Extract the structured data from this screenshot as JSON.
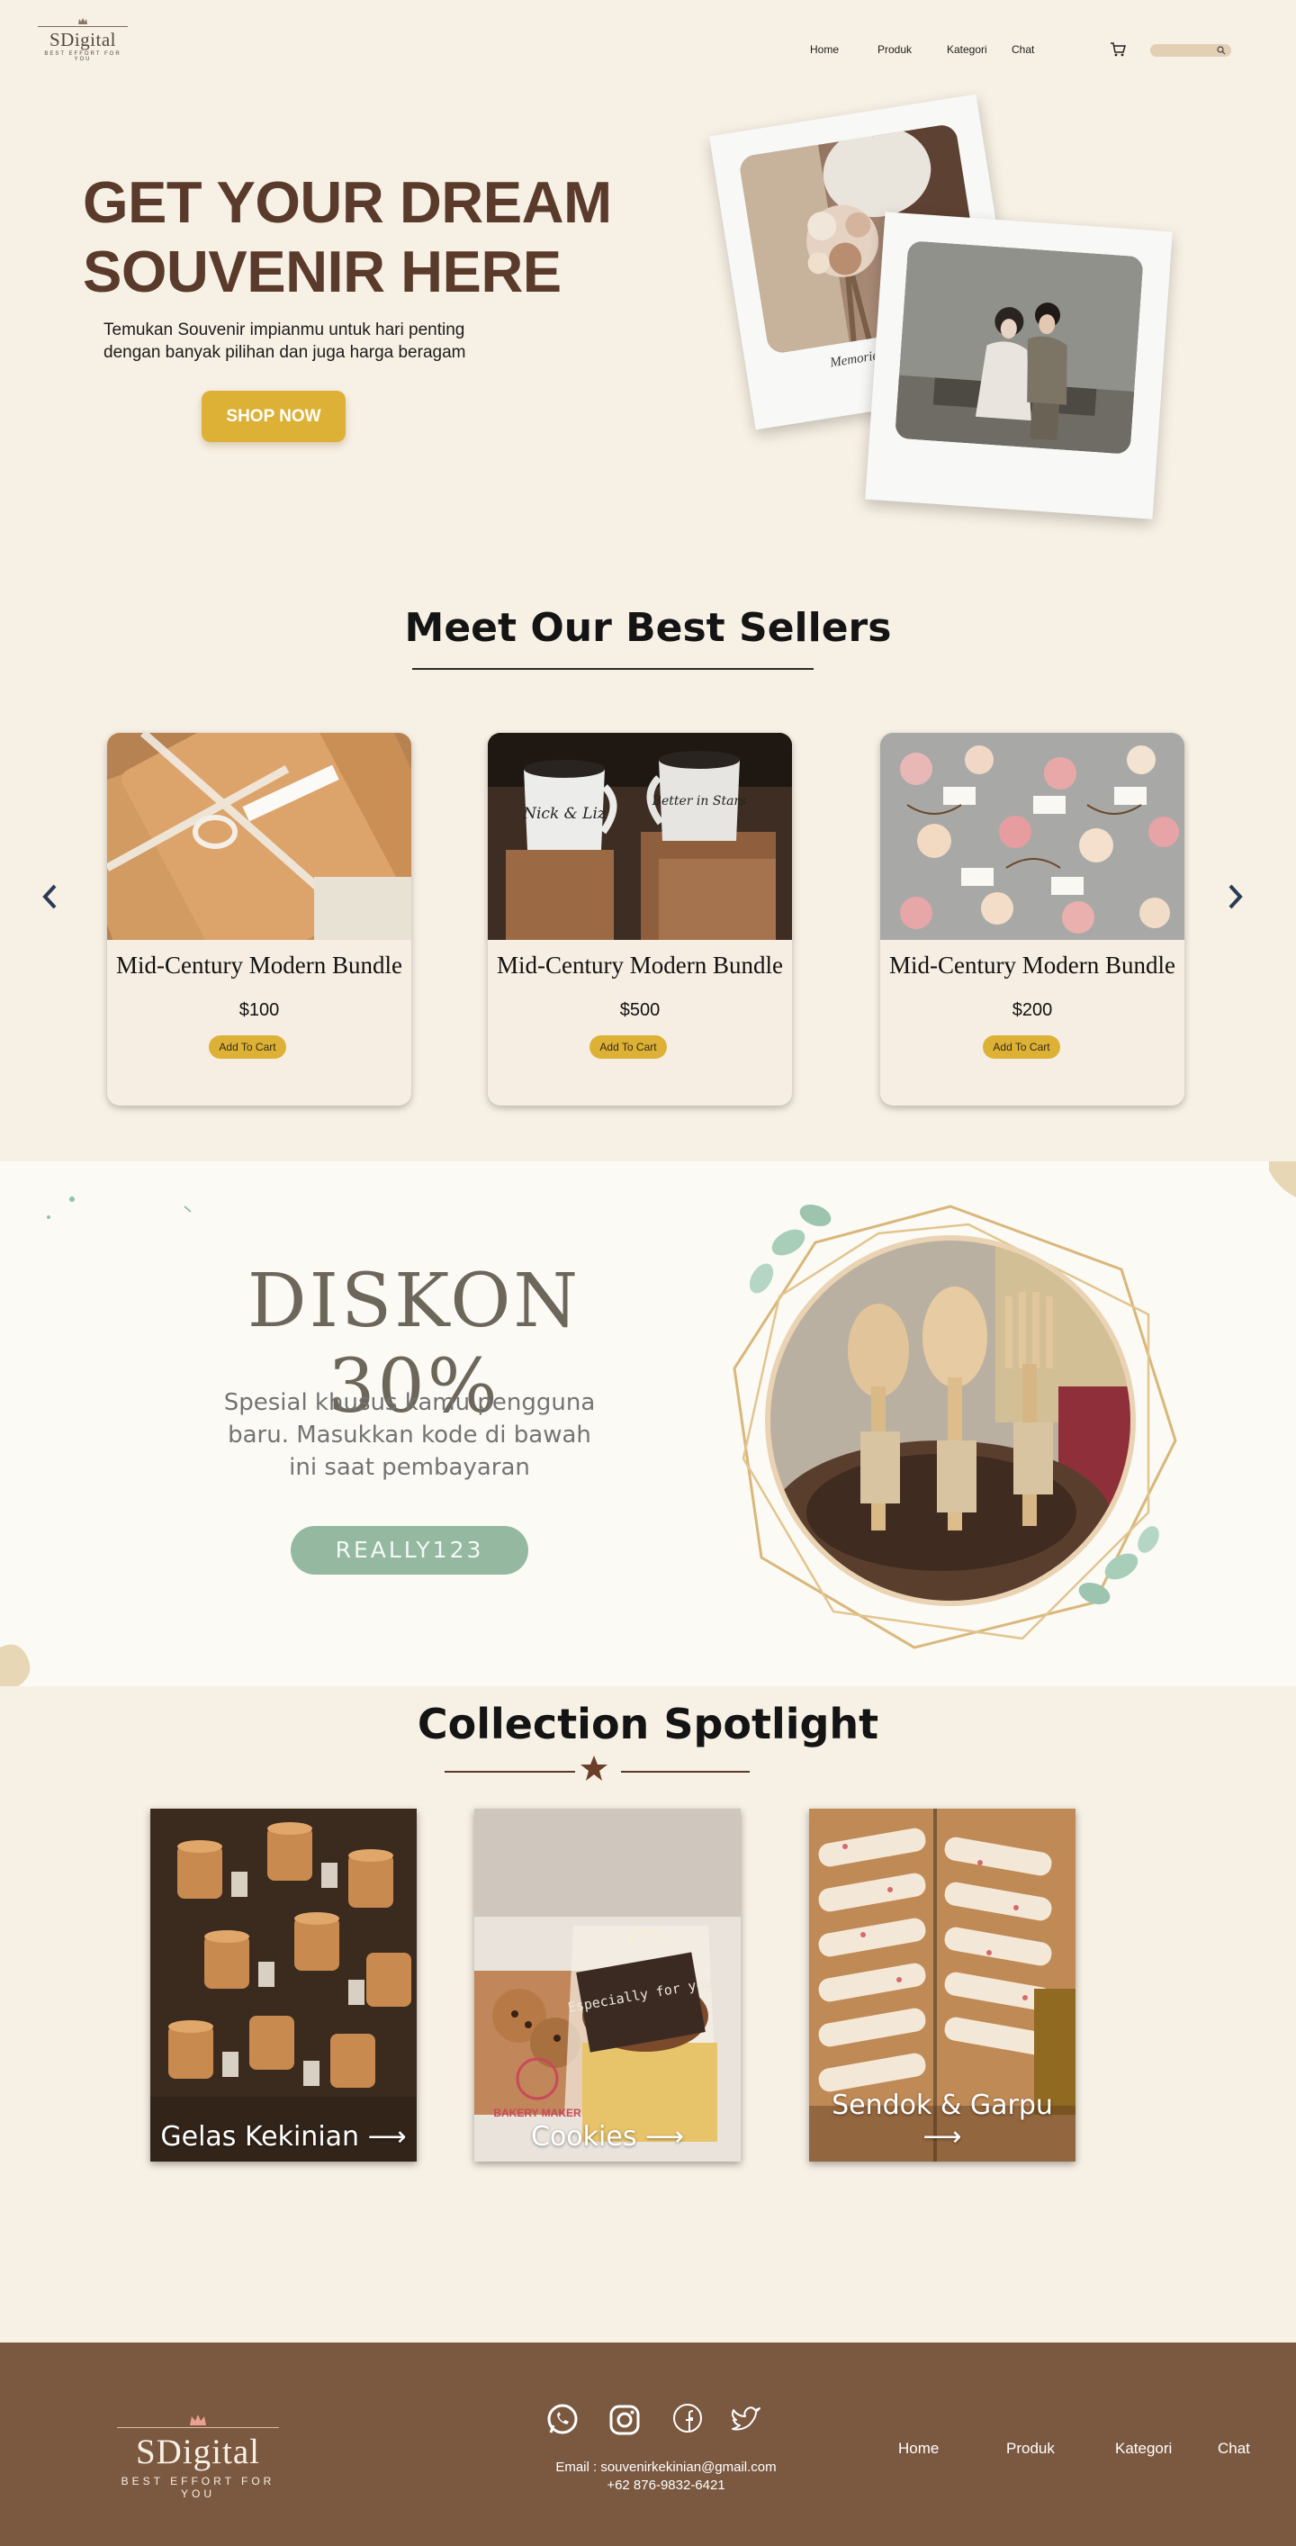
{
  "brand": {
    "name": "SDigital",
    "tagline": "BEST EFFORT FOR YOU"
  },
  "nav": {
    "links": [
      "Home",
      "Produk",
      "Kategori",
      "Chat"
    ]
  },
  "hero": {
    "title_line1": "GET YOUR DREAM",
    "title_line2": "SOUVENIR HERE",
    "subtitle_line1": "Temukan Souvenir impianmu untuk hari penting",
    "subtitle_line2": "dengan banyak pilihan dan juga harga beragam",
    "cta": "SHOP NOW",
    "polaroid_caption": "Memories For Life"
  },
  "best_sellers": {
    "title": "Meet Our Best Sellers",
    "products": [
      {
        "name": "Mid-Century Modern Bundle",
        "price": "$100",
        "button": "Add To Cart"
      },
      {
        "name": "Mid-Century Modern Bundle",
        "price": "$500",
        "button": "Add To Cart"
      },
      {
        "name": "Mid-Century Modern Bundle",
        "price": "$200",
        "button": "Add To Cart"
      }
    ],
    "mug_text_1": "Nick & Liz",
    "mug_text_2": "Better in Stars"
  },
  "promo": {
    "title": "DISKON 30%",
    "subtitle_line1": "Spesial khusus kamu pengguna",
    "subtitle_line2": "baru. Masukkan kode di bawah",
    "subtitle_line3": "ini saat pembayaran",
    "code": "REALLY123"
  },
  "collection": {
    "title": "Collection Spotlight",
    "items": [
      {
        "label": "Gelas Kekinian ⟶"
      },
      {
        "label": "Cookies ⟶"
      },
      {
        "label": "Sendok & Garpu ⟶"
      }
    ],
    "cookie_tag": "Especially for you",
    "cookie_brand": "BAKERY MAKER"
  },
  "footer": {
    "email": "Email : souvenirkekinian@gmail.com",
    "phone": "+62 876-9832-6421",
    "links": [
      "Home",
      "Produk",
      "Kategori",
      "Chat"
    ],
    "social_icons": [
      "whatsapp-icon",
      "instagram-icon",
      "facebook-icon",
      "twitter-icon"
    ]
  },
  "colors": {
    "background": "#f7f0e4",
    "accent_gold": "#dcb136",
    "hero_title": "#5a3a2a",
    "promo_code_bg": "#94b8a0",
    "footer_bg": "#7b5940"
  }
}
